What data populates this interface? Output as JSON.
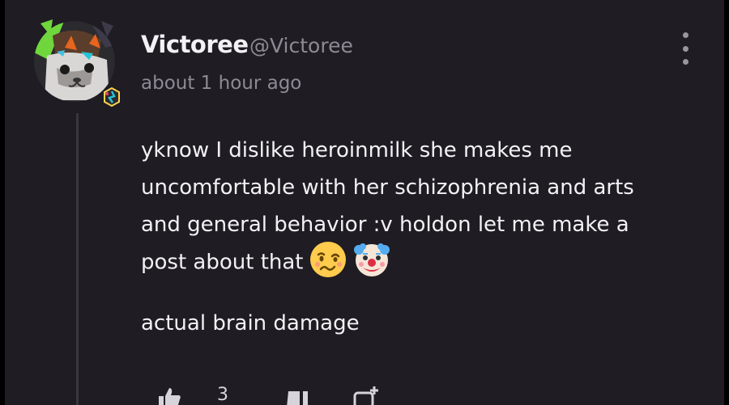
{
  "post": {
    "username": "Victoree",
    "handle": "@Victoree",
    "timestamp": "about 1 hour ago",
    "body_lines": [
      "yknow I dislike heroinmilk she makes me",
      "uncomfortable with her schizophrenia and arts",
      "and general behavior :v holdon let me make a",
      "post about that"
    ],
    "emojis": [
      "woozy-face-icon",
      "clown-face-icon"
    ],
    "second_paragraph": "actual brain damage"
  },
  "actions": {
    "like_count": "3"
  },
  "colors": {
    "card_bg": "#1f1c23",
    "text": "#f3f1f5",
    "muted": "#8e8a94",
    "thread_line": "#3a3640"
  }
}
